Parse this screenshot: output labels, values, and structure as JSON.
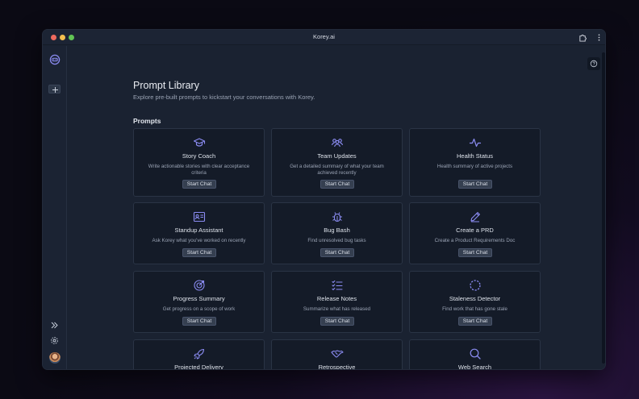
{
  "window": {
    "title": "Korey.ai"
  },
  "header": {
    "title": "Prompt Library",
    "subtitle": "Explore pre-built prompts to kickstart your conversations with Korey."
  },
  "section": {
    "title": "Prompts"
  },
  "colors": {
    "accent": "#8b8cf2",
    "card_bg": "#141b28",
    "button_bg": "#353f50"
  },
  "cards": [
    {
      "title": "Story Coach",
      "description": "Write actionable stories with clear acceptance criteria",
      "button": "Start Chat",
      "icon": "graduation-cap-icon"
    },
    {
      "title": "Team Updates",
      "description": "Get a detailed summary of what your team achieved recently",
      "button": "Start Chat",
      "icon": "team-icon"
    },
    {
      "title": "Health Status",
      "description": "Health summary of active projects",
      "button": "Start Chat",
      "icon": "pulse-icon"
    },
    {
      "title": "Standup Assistant",
      "description": "Ask Korey what you've worked on recently",
      "button": "Start Chat",
      "icon": "id-card-icon"
    },
    {
      "title": "Bug Bash",
      "description": "Find unresolved bug tasks",
      "button": "Start Chat",
      "icon": "bug-icon"
    },
    {
      "title": "Create a PRD",
      "description": "Create a Product Requirements Doc",
      "button": "Start Chat",
      "icon": "pencil-icon"
    },
    {
      "title": "Progress Summary",
      "description": "Get progress on a scope of work",
      "button": "Start Chat",
      "icon": "target-icon"
    },
    {
      "title": "Release Notes",
      "description": "Summarize what has released",
      "button": "Start Chat",
      "icon": "checklist-icon"
    },
    {
      "title": "Staleness Detector",
      "description": "Find work that has gone stale",
      "button": "Start Chat",
      "icon": "dashed-circle-icon"
    },
    {
      "title": "Projected Delivery",
      "description": "",
      "button": "",
      "icon": "rocket-icon"
    },
    {
      "title": "Retrospective",
      "description": "",
      "button": "",
      "icon": "handshake-icon"
    },
    {
      "title": "Web Search",
      "description": "",
      "button": "",
      "icon": "search-icon"
    }
  ]
}
